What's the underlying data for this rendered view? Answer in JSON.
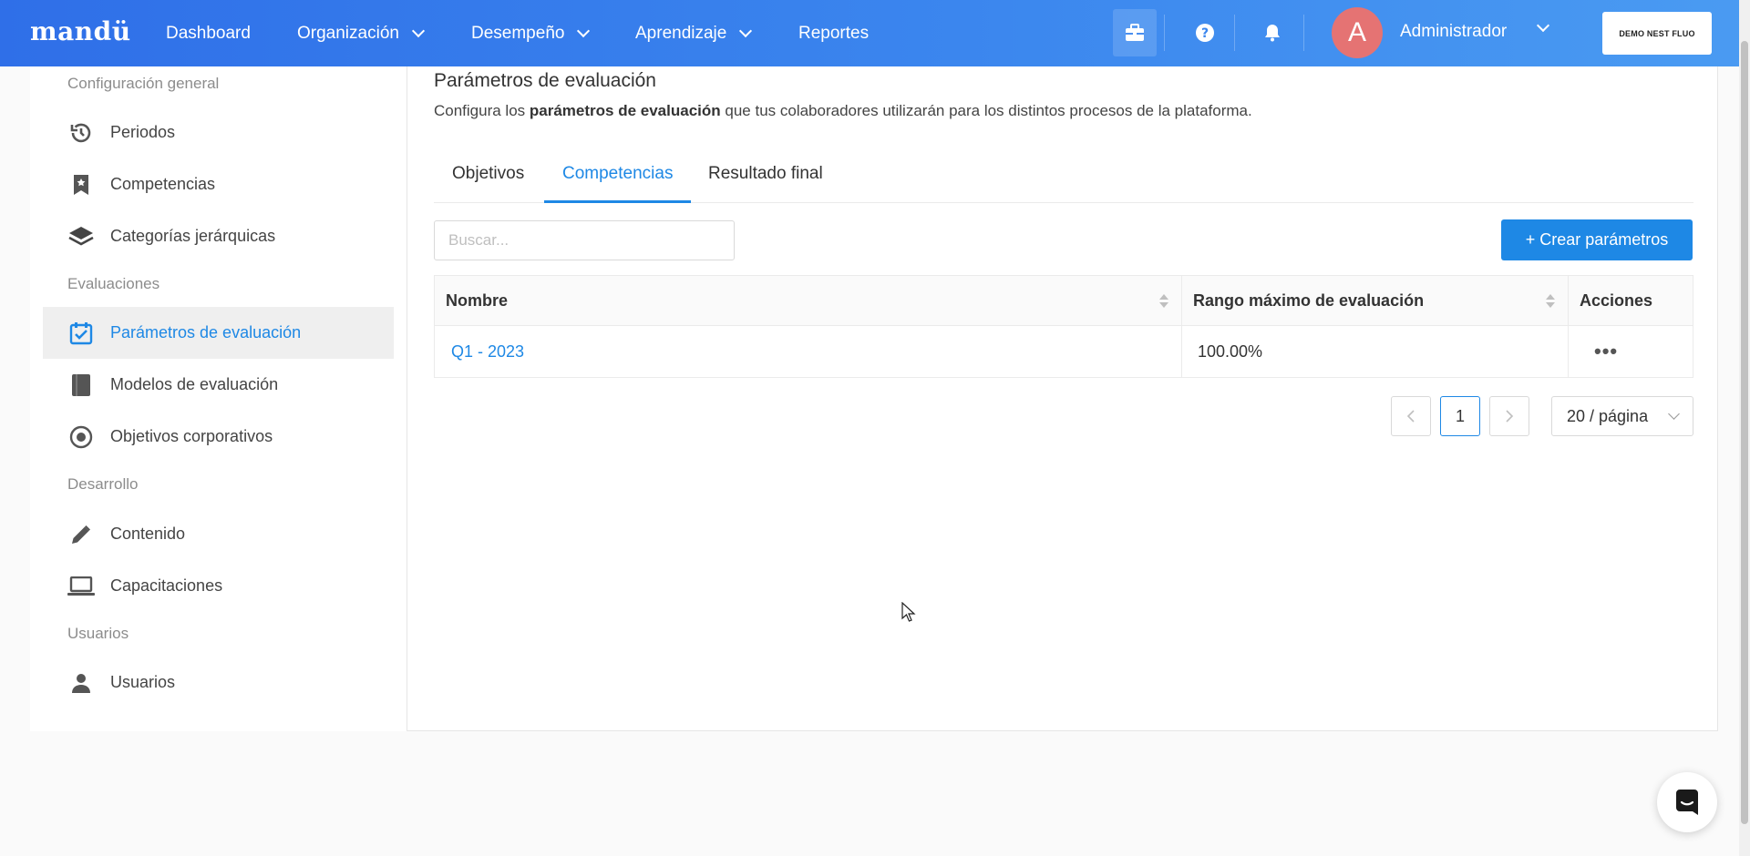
{
  "app": {
    "logo": "mandü"
  },
  "nav": {
    "items": [
      {
        "label": "Dashboard"
      },
      {
        "label": "Organización"
      },
      {
        "label": "Desempeño"
      },
      {
        "label": "Aprendizaje"
      },
      {
        "label": "Reportes"
      }
    ],
    "user": {
      "initial": "A",
      "name": "Administrador"
    },
    "demo_label": "DEMO NEST FLUO"
  },
  "sidebar": {
    "sections": [
      {
        "label": "Configuración general"
      },
      {
        "label": "Evaluaciones"
      },
      {
        "label": "Desarrollo"
      },
      {
        "label": "Usuarios"
      }
    ],
    "items": [
      {
        "label": "Periodos",
        "icon": "history-icon"
      },
      {
        "label": "Competencias",
        "icon": "bookmark-icon"
      },
      {
        "label": "Categorías jerárquicas",
        "icon": "layers-icon"
      },
      {
        "label": "Parámetros de evaluación",
        "icon": "calendar-check-icon",
        "active": true
      },
      {
        "label": "Modelos de evaluación",
        "icon": "book-icon"
      },
      {
        "label": "Objetivos corporativos",
        "icon": "target-icon"
      },
      {
        "label": "Contenido",
        "icon": "pencil-icon"
      },
      {
        "label": "Capacitaciones",
        "icon": "laptop-icon"
      },
      {
        "label": "Usuarios",
        "icon": "user-icon"
      }
    ]
  },
  "main": {
    "title": "Parámetros de evaluación",
    "desc_prefix": "Configura los ",
    "desc_bold": "parámetros de evaluación",
    "desc_suffix": " que tus colaboradores utilizarán para los distintos procesos de la plataforma.",
    "tabs": [
      {
        "label": "Objetivos"
      },
      {
        "label": "Competencias",
        "active": true
      },
      {
        "label": "Resultado final"
      }
    ],
    "search_placeholder": "Buscar...",
    "create_label": "+ Crear parámetros",
    "table": {
      "columns": [
        "Nombre",
        "Rango máximo de evaluación",
        "Acciones"
      ],
      "rows": [
        {
          "name": "Q1 - 2023",
          "range": "100.00%",
          "actions": "•••"
        }
      ]
    },
    "pagination": {
      "current": "1",
      "page_size": "20 / página"
    }
  },
  "colors": {
    "accent": "#1e88e5",
    "nav_start": "#2f6fe8",
    "nav_end": "#4a9bf2",
    "avatar": "#e57373"
  }
}
